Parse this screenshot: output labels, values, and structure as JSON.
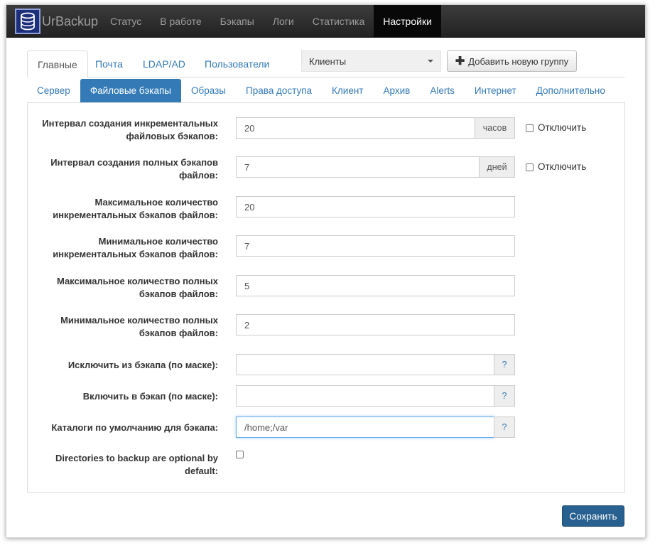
{
  "navbar": {
    "brand": "UrBackup",
    "items": [
      {
        "label": "Статус"
      },
      {
        "label": "В работе"
      },
      {
        "label": "Бэкапы"
      },
      {
        "label": "Логи"
      },
      {
        "label": "Статистика"
      },
      {
        "label": "Настройки",
        "active": true
      }
    ]
  },
  "top_tabs": {
    "items": [
      "Главные",
      "Почта",
      "LDAP/AD",
      "Пользователи"
    ],
    "group_select": "Клиенты",
    "add_group": "Добавить новую группу"
  },
  "sub_tabs": [
    "Сервер",
    "Файловые бэкапы",
    "Образы",
    "Права доступа",
    "Клиент",
    "Архив",
    "Alerts",
    "Интернет",
    "Дополнительно"
  ],
  "form": {
    "incr_interval": {
      "label_1": "Интервал создания инкрементальных",
      "label_2": "файловых бэкапов:",
      "value": "20",
      "unit": "часов",
      "disable": "Отключить"
    },
    "full_interval": {
      "label_1": "Интервал создания полных бэкапов",
      "label_2": "файлов:",
      "value": "7",
      "unit": "дней",
      "disable": "Отключить"
    },
    "max_incr": {
      "label_1": "Максимальное количество",
      "label_2": "инкрементальных бэкапов файлов:",
      "value": "20"
    },
    "min_incr": {
      "label_1": "Минимальное количество",
      "label_2": "инкрементальных бэкапов файлов:",
      "value": "7"
    },
    "max_full": {
      "label_1": "Максимальное количество полных",
      "label_2": "бэкапов файлов:",
      "value": "5"
    },
    "min_full": {
      "label_1": "Минимальное количество полных",
      "label_2": "бэкапов файлов:",
      "value": "2"
    },
    "exclude": {
      "label": "Исключить из бэкапа (по маске):",
      "value": "",
      "help": "?"
    },
    "include": {
      "label": "Включить в бэкап (по маске):",
      "value": "",
      "help": "?"
    },
    "default_dirs": {
      "label": "Каталоги по умолчанию для бэкапа:",
      "value": "/home;/var",
      "help": "?"
    },
    "optional": {
      "label_1": "Directories to backup are optional by",
      "label_2": "default:"
    }
  },
  "save_label": "Сохранить",
  "colors": {
    "navbar_bg": "#222222",
    "active_tab": "#337ab7",
    "save_button": "#286090"
  }
}
